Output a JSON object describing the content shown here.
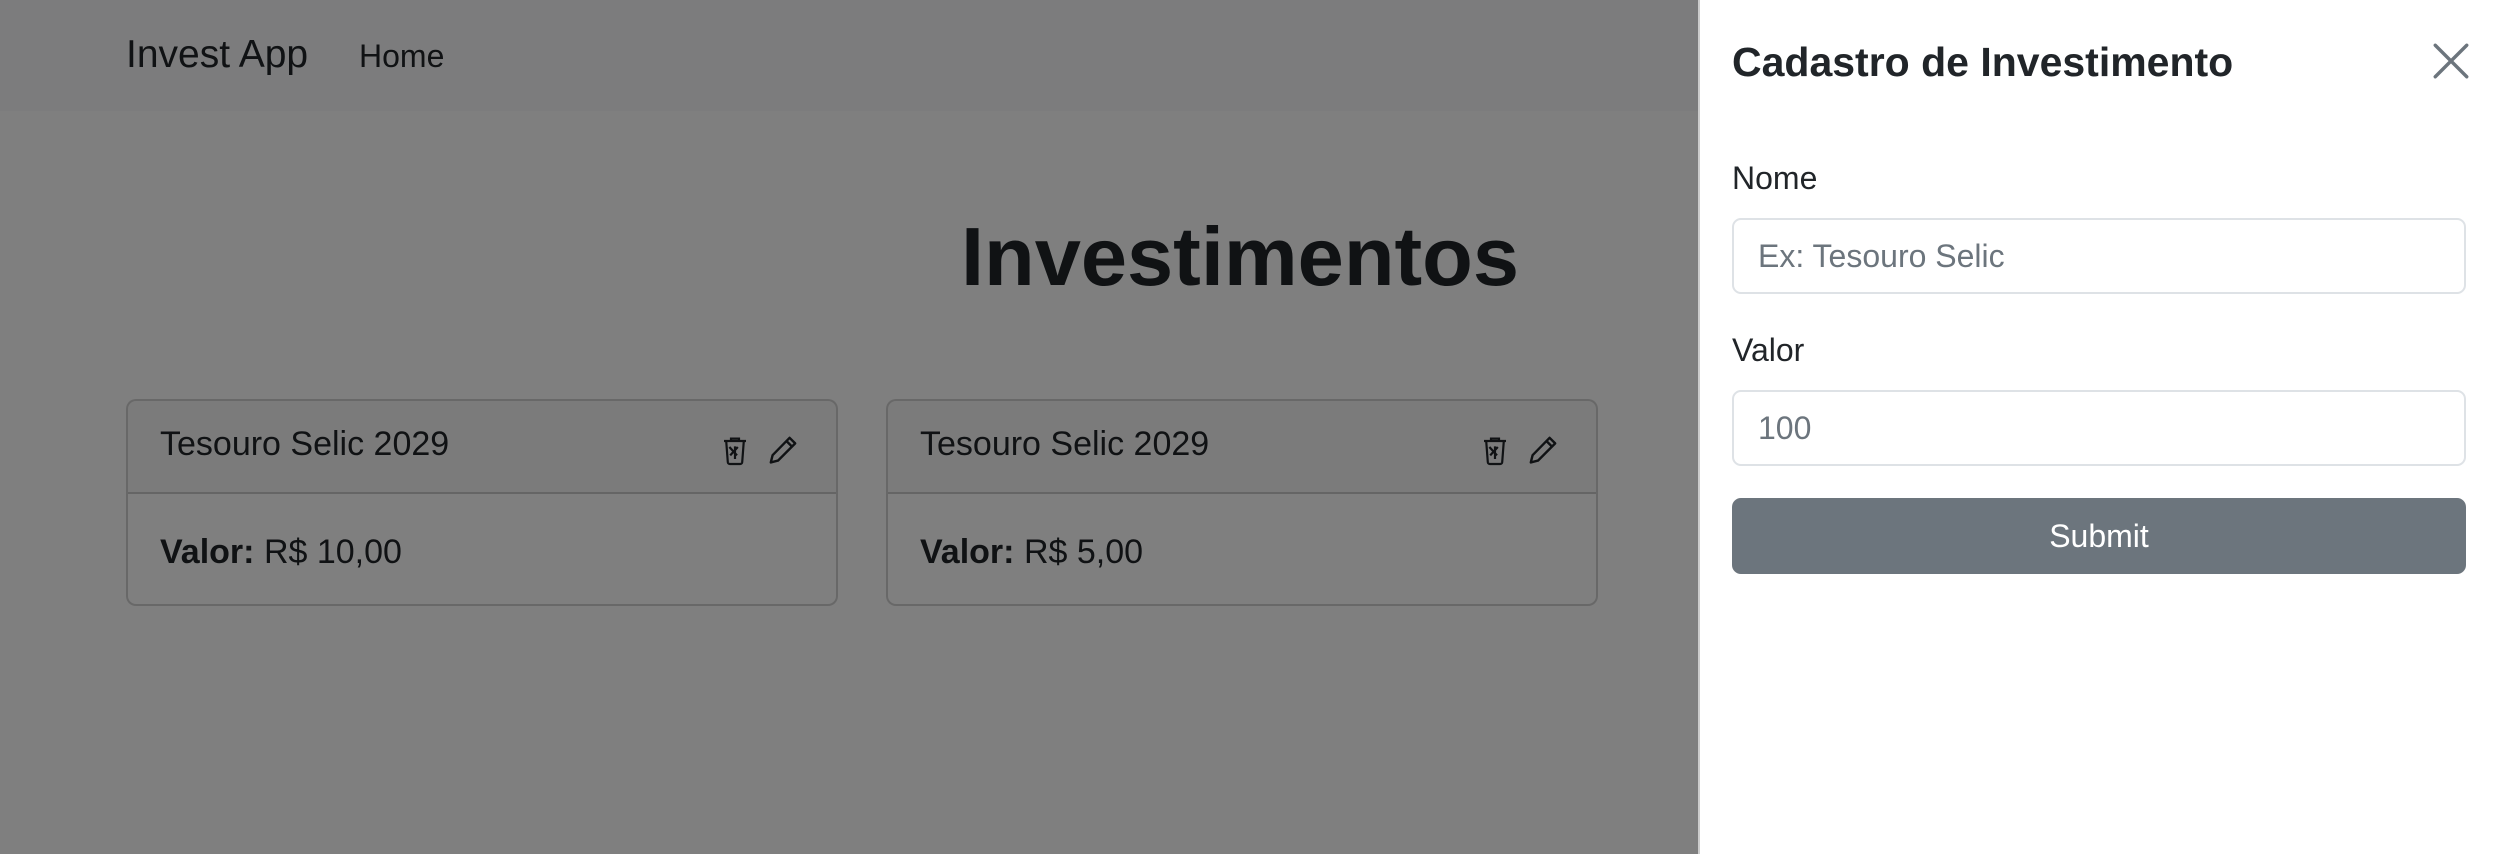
{
  "navbar": {
    "brand": "Invest App",
    "links": [
      {
        "label": "Home"
      }
    ]
  },
  "main": {
    "title": "Investimentos",
    "cards": [
      {
        "name": "Tesouro Selic 2029",
        "value_label": "Valor:",
        "value": "R$ 10,00"
      },
      {
        "name": "Tesouro Selic 2029",
        "value_label": "Valor:",
        "value": "R$ 5,00"
      }
    ]
  },
  "offcanvas": {
    "title": "Cadastro de Investimento",
    "fields": {
      "nome": {
        "label": "Nome",
        "placeholder": "Ex: Tesouro Selic",
        "value": ""
      },
      "valor": {
        "label": "Valor",
        "placeholder": "100",
        "value": ""
      }
    },
    "submit_label": "Submit"
  },
  "icons": {
    "delete": "trash-icon",
    "edit": "pencil-icon",
    "close": "close-icon"
  },
  "colors": {
    "backdrop": "#000000",
    "submit_button": "#6c757d",
    "navbar": "#f8f9fa"
  }
}
